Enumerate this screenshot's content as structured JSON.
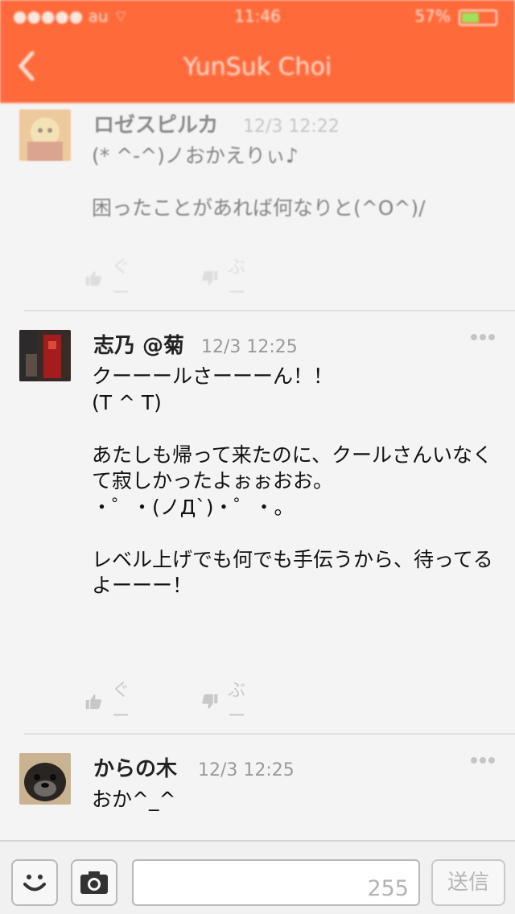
{
  "status_bar": {
    "carrier": "●●●●● au ⌔",
    "time": "11:46",
    "battery_text": "57%",
    "battery_level": 0.57
  },
  "header": {
    "title": "YunSuk Choi",
    "back_icon": "chevron-left-icon",
    "color": "#ff6a3a"
  },
  "messages": [
    {
      "name": "ロゼスピルカ",
      "time": "12/3 12:22",
      "body": "(* ^-^)ノおかえりぃ♪\n\n困ったことがあれば何なりと(^O^)/",
      "like_label": "ぐー",
      "dislike_label": "ぶー"
    },
    {
      "name": "志乃 @菊",
      "time": "12/3 12:25",
      "body": "クーーールさーーーん！！\n(T ^ T)\n\nあたしも帰って来たのに、クールさんいなくて寂しかったよぉぉおお。\n・゜・(ノД`)・゜・。\n\nレベル上げでも何でも手伝うから、待ってるよーーー！",
      "like_label": "ぐー",
      "dislike_label": "ぶー"
    },
    {
      "name": "からの木",
      "time": "12/3 12:25",
      "body": "おか^_^"
    }
  ],
  "composer": {
    "char_count": "255",
    "send_label": "送信",
    "emoji_icon": "smiley-icon",
    "camera_icon": "camera-icon"
  }
}
